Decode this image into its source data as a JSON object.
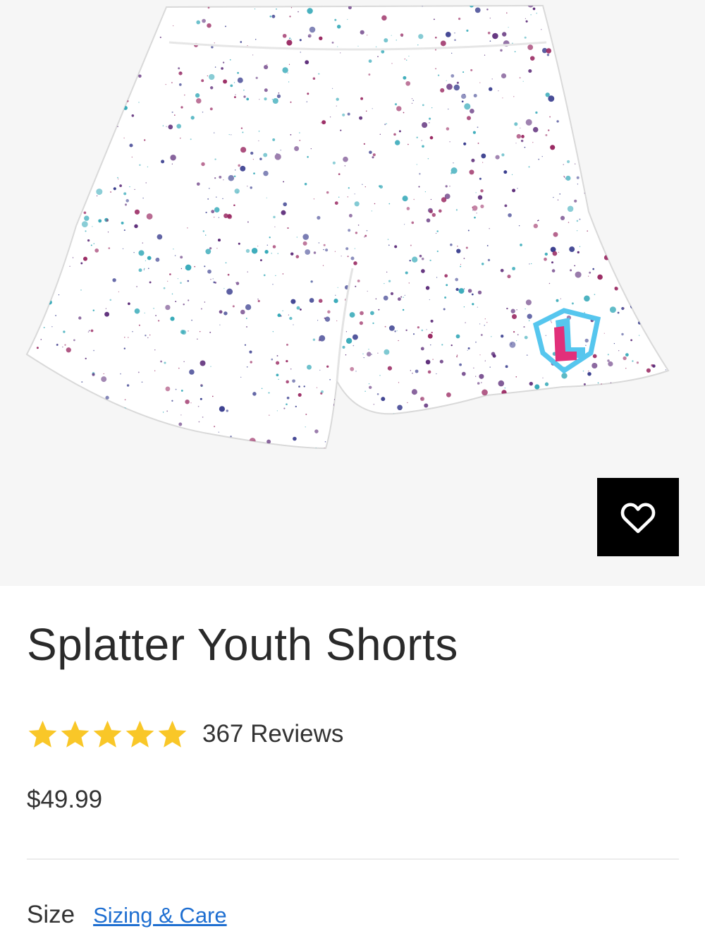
{
  "product": {
    "title": "Splatter Youth Shorts",
    "image_icon": "splatter-shorts-image",
    "wishlist_icon": "heart-icon",
    "rating": {
      "stars": 5,
      "max_stars": 5,
      "reviews_label": "367 Reviews"
    },
    "price": "$49.99",
    "size_label": "Size",
    "sizing_link": "Sizing & Care"
  },
  "colors": {
    "hero_bg": "#f6f6f6",
    "star": "#f9c728",
    "link": "#1f6fd1",
    "splatter_purple": "#5b2a78",
    "splatter_teal": "#35a9b8",
    "splatter_magenta": "#9a2a63",
    "logo_blue": "#56c6ee",
    "logo_pink": "#e1307a"
  }
}
